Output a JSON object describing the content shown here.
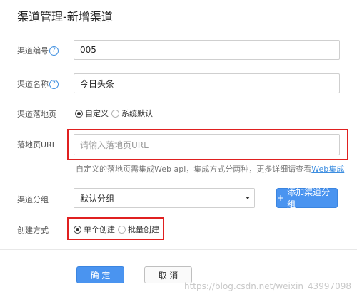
{
  "page": {
    "title": "渠道管理-新增渠道"
  },
  "form": {
    "channel_id": {
      "label": "渠道编号",
      "value": "005"
    },
    "channel_name": {
      "label": "渠道名称",
      "value": "今日头条"
    },
    "landing_type": {
      "label": "渠道落地页",
      "options": [
        "自定义",
        "系统默认"
      ],
      "selected": "自定义"
    },
    "landing_url": {
      "label": "落地页URL",
      "placeholder": "请输入落地页URL"
    },
    "hint": {
      "text": "自定义的落地页需集成Web api，集成方式分两种，更多详细请查看",
      "link": "Web集成"
    },
    "channel_group": {
      "label": "渠道分组",
      "value": "默认分组",
      "add_button": "添加渠道分组"
    },
    "create_mode": {
      "label": "创建方式",
      "options": [
        "单个创建",
        "批量创建"
      ],
      "selected": "单个创建"
    }
  },
  "help_icon": "?",
  "plus_icon": "+",
  "actions": {
    "confirm": "确 定",
    "cancel": "取 消"
  },
  "watermark": "https://blog.csdn.net/weixin_43997098",
  "colors": {
    "primary": "#4a94f0",
    "highlight": "#e02020",
    "link": "#3d8ee0"
  }
}
